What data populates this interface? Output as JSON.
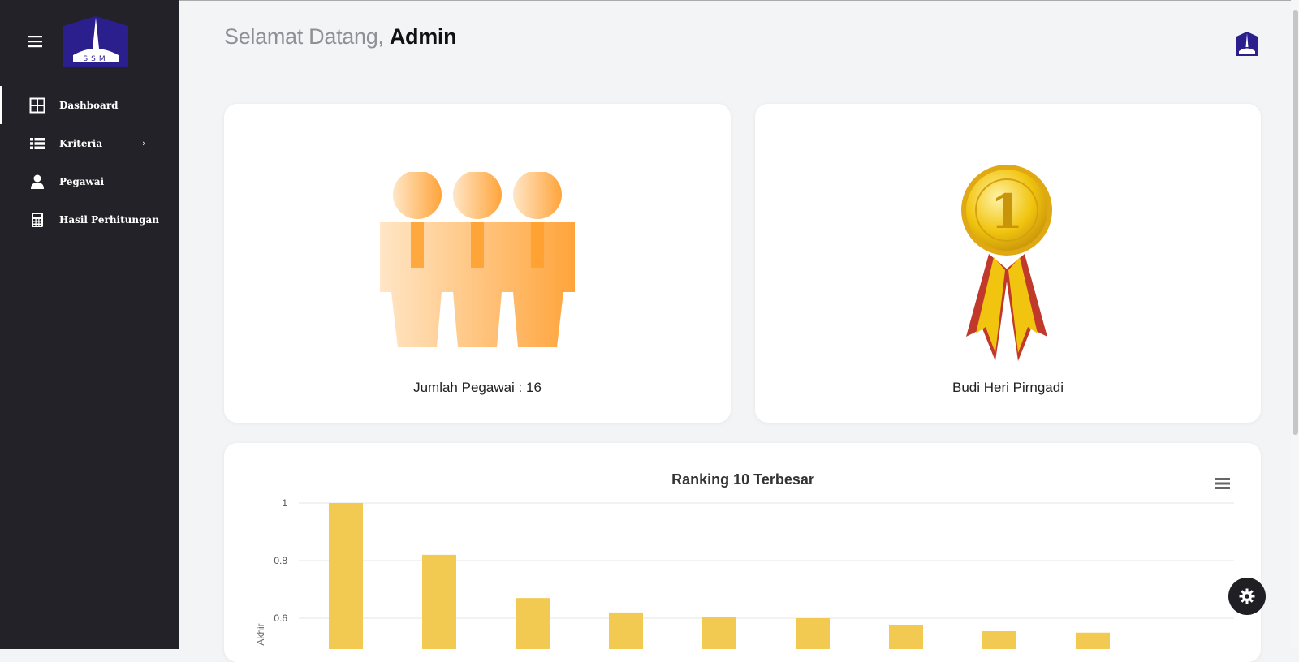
{
  "sidebar": {
    "logo_text": "SSM",
    "items": [
      {
        "label": "Dashboard",
        "icon": "dashboard-grid-icon",
        "active": true,
        "has_chevron": false
      },
      {
        "label": "Kriteria",
        "icon": "list-icon",
        "active": false,
        "has_chevron": true
      },
      {
        "label": "Pegawai",
        "icon": "user-icon",
        "active": false,
        "has_chevron": false
      },
      {
        "label": "Hasil Perhitungan",
        "icon": "calculator-icon",
        "active": false,
        "has_chevron": true
      }
    ],
    "chevron": "›"
  },
  "header": {
    "greeting_prefix": "Selamat Datang, ",
    "greeting_name": "Admin"
  },
  "cards": {
    "employees_caption": "Jumlah Pegawai : 16",
    "top_employee_caption": "Budi Heri Pirngadi"
  },
  "colors": {
    "sidebar_bg": "#222228",
    "bar_color": "#f2ca52",
    "people_orange": "#ffa43b",
    "medal_gold": "#f1c40f",
    "ribbon_red": "#c0392b"
  },
  "chart_data": {
    "type": "bar",
    "title": "Ranking 10 Terbesar",
    "ylabel": "Akhir",
    "xlabel": "",
    "ylim": [
      0,
      1
    ],
    "yticks": [
      "1",
      "0.8",
      "0.6"
    ],
    "grid": true,
    "values": [
      1.0,
      0.82,
      0.67,
      0.62,
      0.605,
      0.6,
      0.575,
      0.555,
      0.55
    ]
  }
}
